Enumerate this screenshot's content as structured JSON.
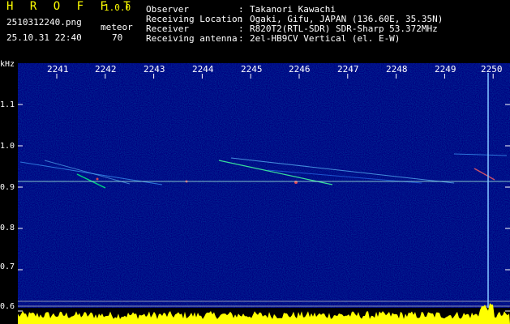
{
  "header": {
    "app_name": "H R O F F T",
    "version": "1.0.0",
    "filename": "2510312240.png",
    "datetime": "25.10.31 22:40",
    "meteor_label": "meteor",
    "meteor_count": "70",
    "info_labels": [
      "Observer",
      "Receiving Location",
      "Receiver",
      "Receiving antenna"
    ],
    "info_colons": [
      ":",
      ":",
      ":",
      ":"
    ],
    "info_values": [
      "Takanori Kawachi",
      "Ogaki, Gifu, JAPAN (136.60E, 35.35N)",
      "R820T2(RTL-SDR) SDR-Sharp 53.372MHz",
      "2el-HB9CV Vertical (el. E-W)"
    ]
  },
  "spectrogram": {
    "y_unit": "kHz",
    "y_ticks": [
      "1.1",
      "1.0",
      "0.9",
      "0.8",
      "0.7",
      "0.6"
    ],
    "y_tick_values": [
      1.1,
      1.0,
      0.9,
      0.8,
      0.7,
      0.6
    ],
    "x_ticks": [
      "2241",
      "2242",
      "2243",
      "2244",
      "2245",
      "2246",
      "2247",
      "2248",
      "2249",
      "2250"
    ],
    "colors": {
      "background": "#000080",
      "carrier": "#7fffd4",
      "histogram": "#ffff00",
      "label": "#ffffff"
    }
  }
}
